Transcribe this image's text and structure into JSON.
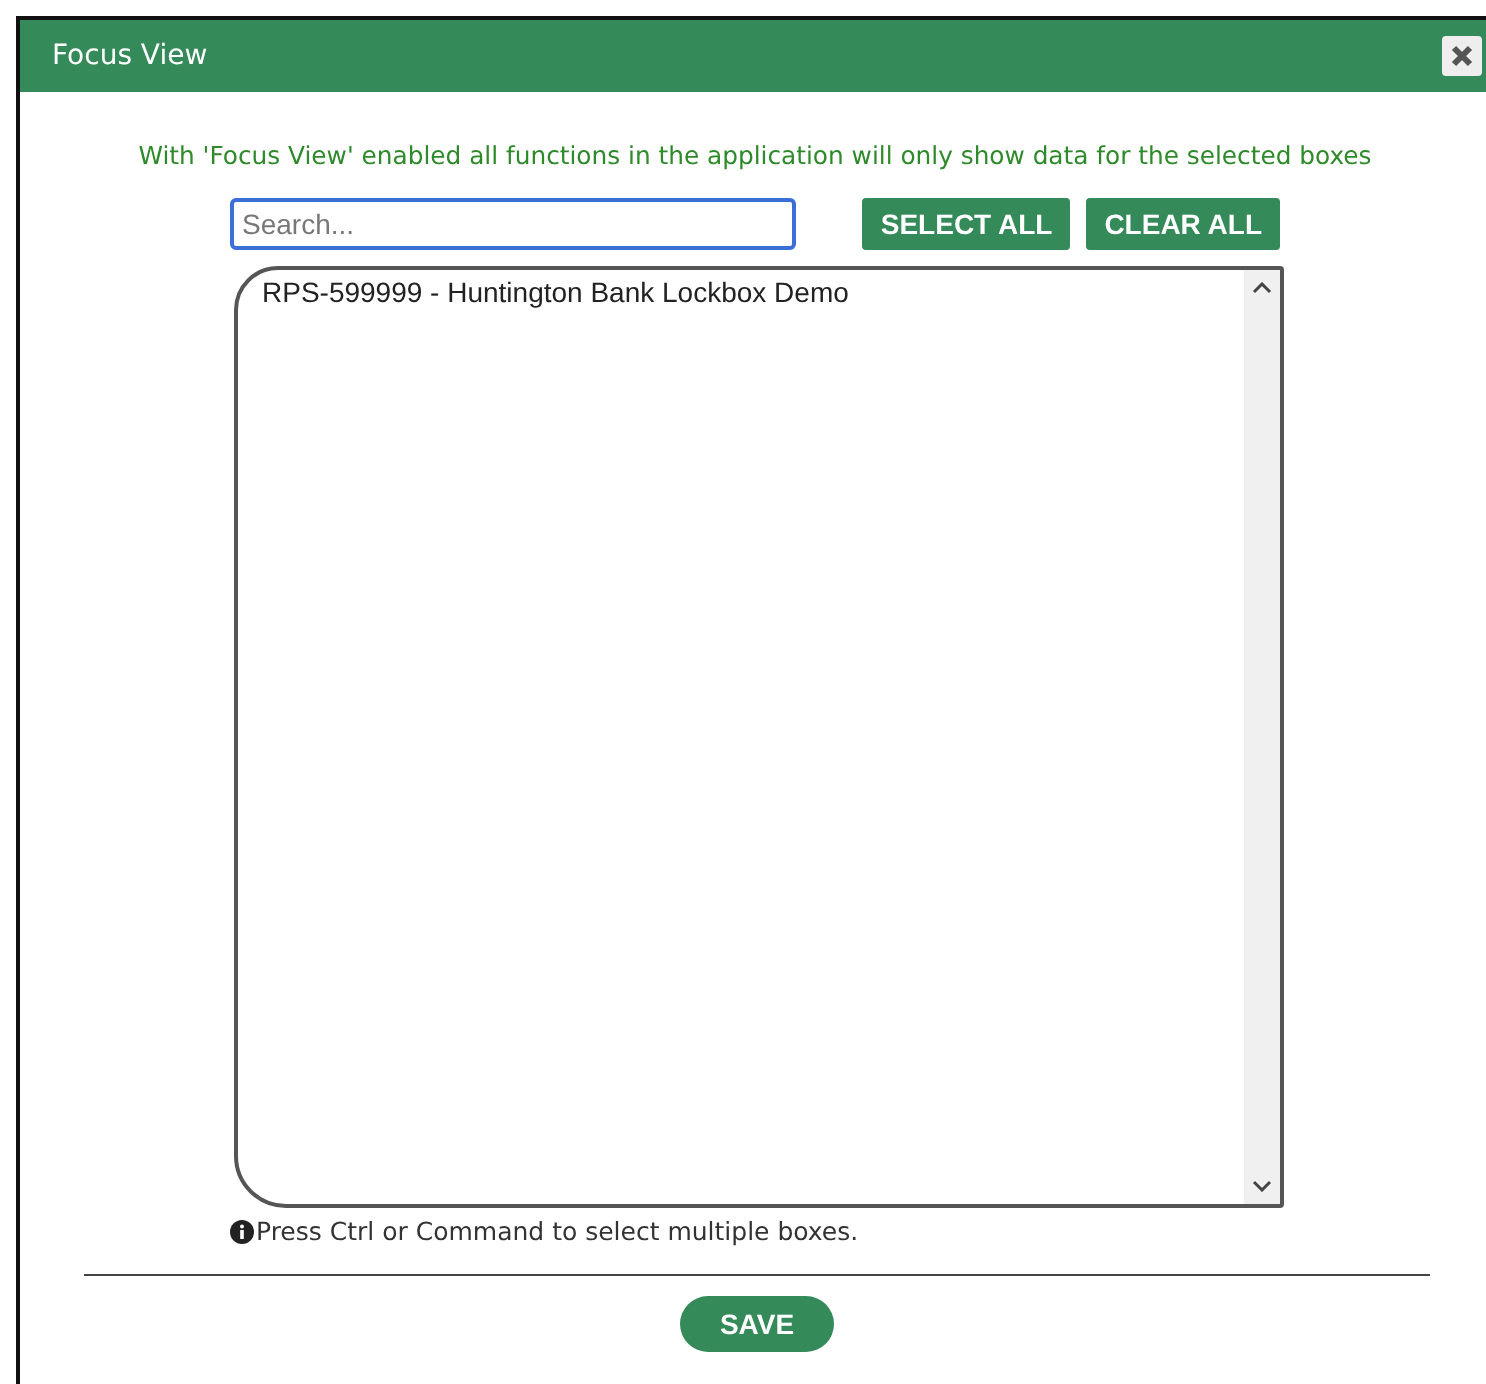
{
  "window": {
    "title": "Focus View"
  },
  "intro": "With 'Focus View' enabled all functions in the application will only show data for the selected boxes",
  "search": {
    "placeholder": "Search..."
  },
  "buttons": [
    "SELECT ALL",
    "CLEAR ALL"
  ],
  "boxes": [
    {
      "label": "RPS-599999 - Huntington Bank Lockbox Demo",
      "selected": false
    }
  ],
  "hint": "Press Ctrl or Command to select multiple boxes.",
  "save_button": "SAVE"
}
